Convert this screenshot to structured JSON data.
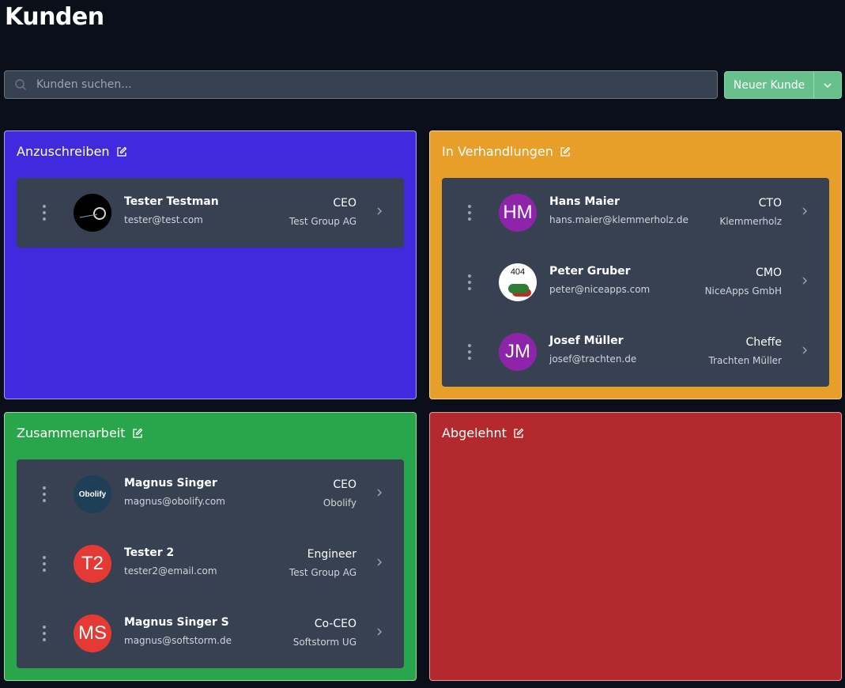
{
  "title": "Kunden",
  "search": {
    "placeholder": "Kunden suchen..."
  },
  "new_customer": {
    "label": "Neuer Kunde"
  },
  "columns": [
    {
      "title": "Anzuschreiben",
      "color": "#4129dd",
      "customers": [
        {
          "name": "Tester Testman",
          "email": "tester@test.com",
          "role": "CEO",
          "company": "Test Group AG",
          "avatar": {
            "type": "photo",
            "icon": "dark-photo"
          }
        }
      ]
    },
    {
      "title": "In Verhandlungen",
      "color": "#e89f2a",
      "customers": [
        {
          "name": "Hans Maier",
          "email": "hans.maier@klemmerholz.de",
          "role": "CTO",
          "company": "Klemmerholz",
          "avatar": {
            "type": "initials",
            "text": "HM",
            "color": "#8e24aa"
          }
        },
        {
          "name": "Peter Gruber",
          "email": "peter@niceapps.com",
          "role": "CMO",
          "company": "NiceApps GmbH",
          "avatar": {
            "type": "image",
            "text": "404"
          }
        },
        {
          "name": "Josef Müller",
          "email": "josef@trachten.de",
          "role": "Cheffe",
          "company": "Trachten Müller",
          "avatar": {
            "type": "initials",
            "text": "JM",
            "color": "#8e24aa"
          }
        }
      ]
    },
    {
      "title": "Zusammenarbeit",
      "color": "#29a64b",
      "customers": [
        {
          "name": "Magnus Singer",
          "email": "magnus@obolify.com",
          "role": "CEO",
          "company": "Obolify",
          "avatar": {
            "type": "logo",
            "text": "Obolify",
            "color": "#1f3f57"
          }
        },
        {
          "name": "Tester 2",
          "email": "tester2@email.com",
          "role": "Engineer",
          "company": "Test Group AG",
          "avatar": {
            "type": "initials",
            "text": "T2",
            "color": "#e53935"
          }
        },
        {
          "name": "Magnus Singer S",
          "email": "magnus@softstorm.de",
          "role": "Co-CEO",
          "company": "Softstorm UG",
          "avatar": {
            "type": "initials",
            "text": "MS",
            "color": "#e53935"
          }
        }
      ]
    },
    {
      "title": "Abgelehnt",
      "color": "#b4292e",
      "customers": []
    }
  ]
}
